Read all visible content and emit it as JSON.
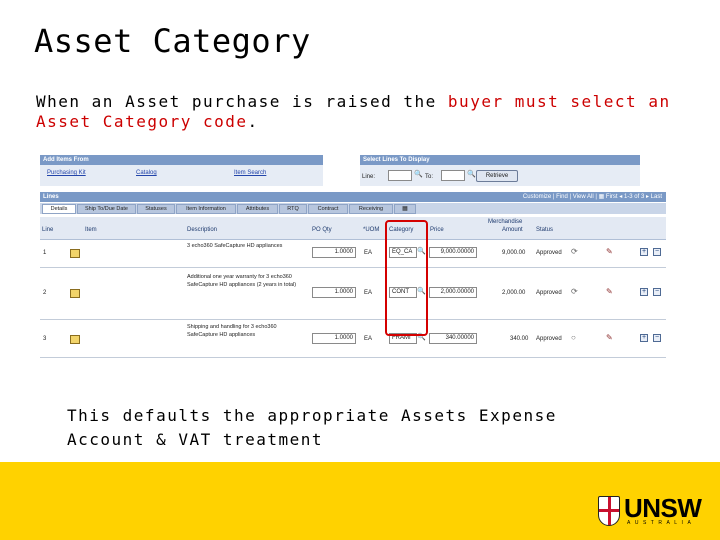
{
  "slide": {
    "title": "Asset Category",
    "intro_before": "When an Asset purchase is raised the ",
    "intro_highlight": "buyer must select an Asset Category code",
    "intro_after": ".",
    "note_line1": "This defaults the appropriate Assets Expense",
    "note_line2": "Account & VAT treatment"
  },
  "add_items": {
    "header": "Add Items From",
    "links": [
      "Purchasing Kit",
      "Catalog",
      "Item Search"
    ]
  },
  "select_lines": {
    "header": "Select Lines To Display",
    "line_label": "Line:",
    "to_label": "To:",
    "retrieve_label": "Retrieve"
  },
  "lines": {
    "header": "Lines",
    "customize": "Customize",
    "find": "Find",
    "view_all": "View All",
    "first": "First",
    "range": "1-3 of 3",
    "last": "Last",
    "tabs": [
      "Details",
      "Ship To/Due Date",
      "Statuses",
      "Item Information",
      "Attributes",
      "RTQ",
      "Contract",
      "Receiving"
    ],
    "columns": {
      "line": "Line",
      "item": "Item",
      "description": "Description",
      "po_qty": "PO Qty",
      "uom": "*UOM",
      "category": "Category",
      "price": "Price",
      "merch_amount_1": "Merchandise",
      "merch_amount_2": "Amount",
      "status": "Status"
    },
    "rows": [
      {
        "line": "1",
        "description": "3 echo360 SafeCapture HD appliances",
        "qty": "1.0000",
        "uom": "EA",
        "category": "EQ_CA",
        "price": "9,000.00000",
        "amount": "9,000.00",
        "status": "Approved"
      },
      {
        "line": "2",
        "description": "Additional one year warranty for 3 echo360 SafeCapture HD appliances (2 years in total)",
        "qty": "1.0000",
        "uom": "EA",
        "category": "CONT",
        "price": "2,000.00000",
        "amount": "2,000.00",
        "status": "Approved"
      },
      {
        "line": "3",
        "description": "Shipping and handling for 3 echo360 SafeCapture HD appliances",
        "qty": "1.0000",
        "uom": "EA",
        "category": "FRAMI",
        "price": "340.00000",
        "amount": "340.00",
        "status": "Approved"
      }
    ]
  },
  "logo": {
    "name": "UNSW",
    "subtitle": "AUSTRALIA"
  },
  "colors": {
    "highlight": "#cc0000",
    "footer": "#ffd200",
    "panel_header": "#7a99c6"
  }
}
